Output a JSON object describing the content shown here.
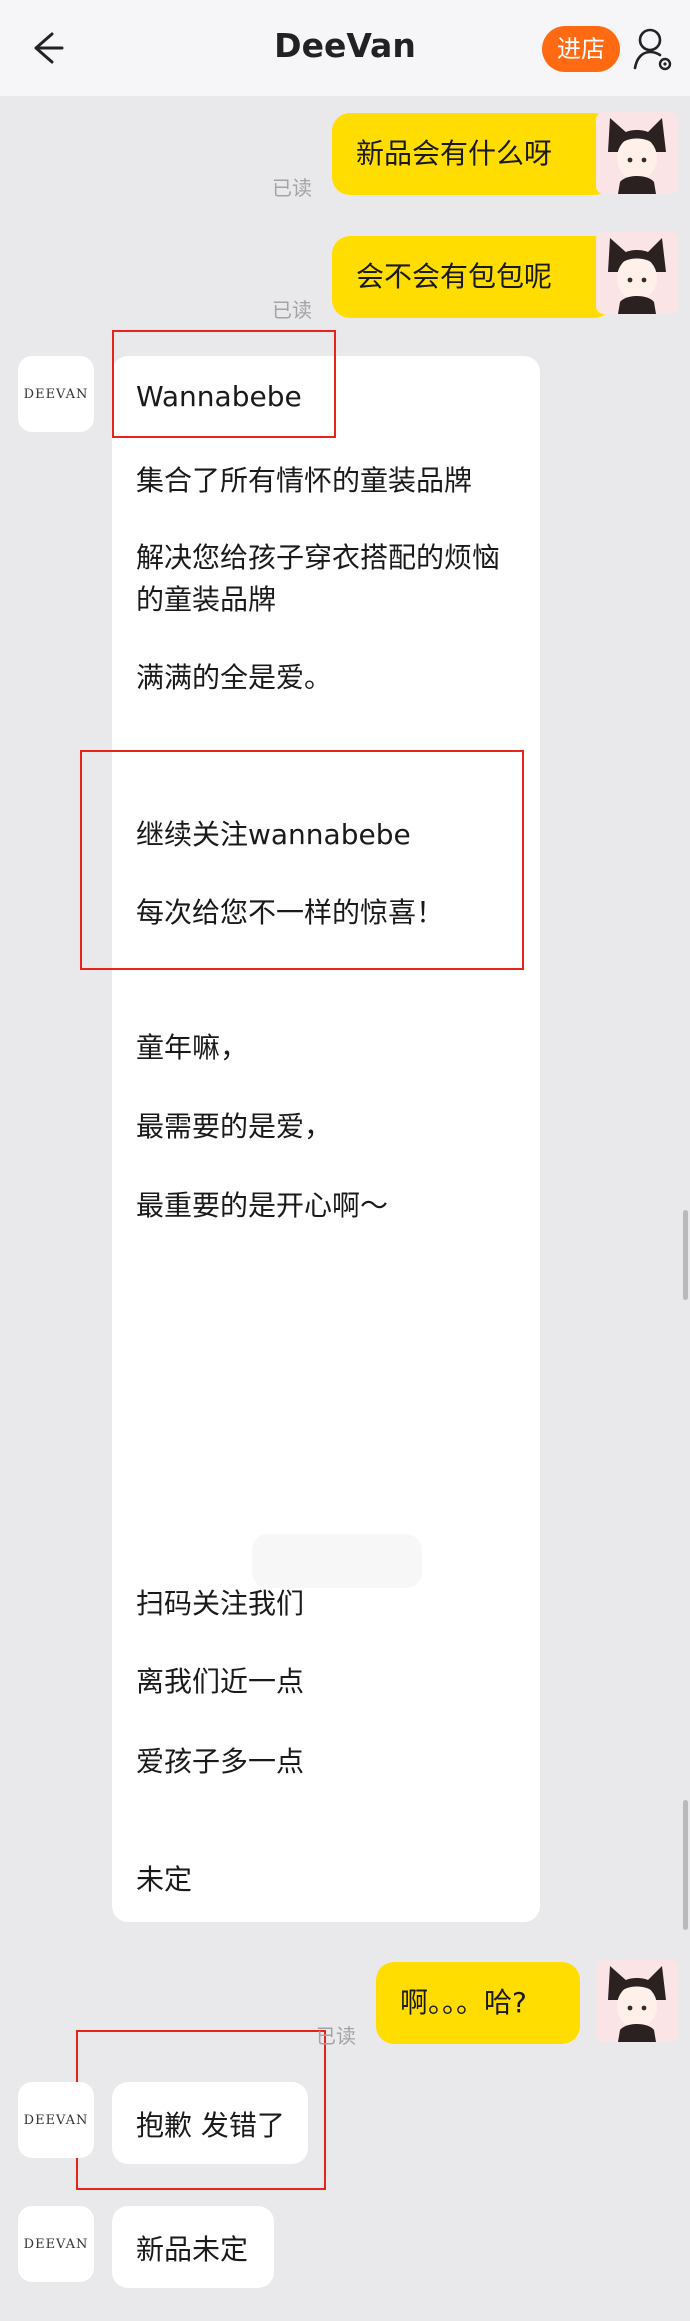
{
  "header": {
    "title": "DeeVan",
    "store_button": "进店"
  },
  "shop": {
    "avatar_text": "DEEVAN"
  },
  "messages": {
    "out1": {
      "text": "新品会有什么呀",
      "status": "已读"
    },
    "out2": {
      "text": "会不会有包包呢",
      "status": "已读"
    },
    "in_long": {
      "lines": [
        "Wannabebe",
        "集合了所有情怀的童装品牌",
        "解决您给孩子穿衣搭配的烦恼",
        "的童装品牌",
        "满满的全是爱。",
        "继续关注wannabebe",
        "每次给您不一样的惊喜！",
        "童年嘛，",
        "最需要的是爱，",
        "最重要的是开心啊～",
        "扫码关注我们",
        "离我们近一点",
        "爱孩子多一点",
        "未定"
      ]
    },
    "out3": {
      "text": "啊。。。哈?",
      "status": "已读"
    },
    "in2": {
      "text": "抱歉 发错了"
    },
    "in3": {
      "text": "新品未定"
    }
  }
}
